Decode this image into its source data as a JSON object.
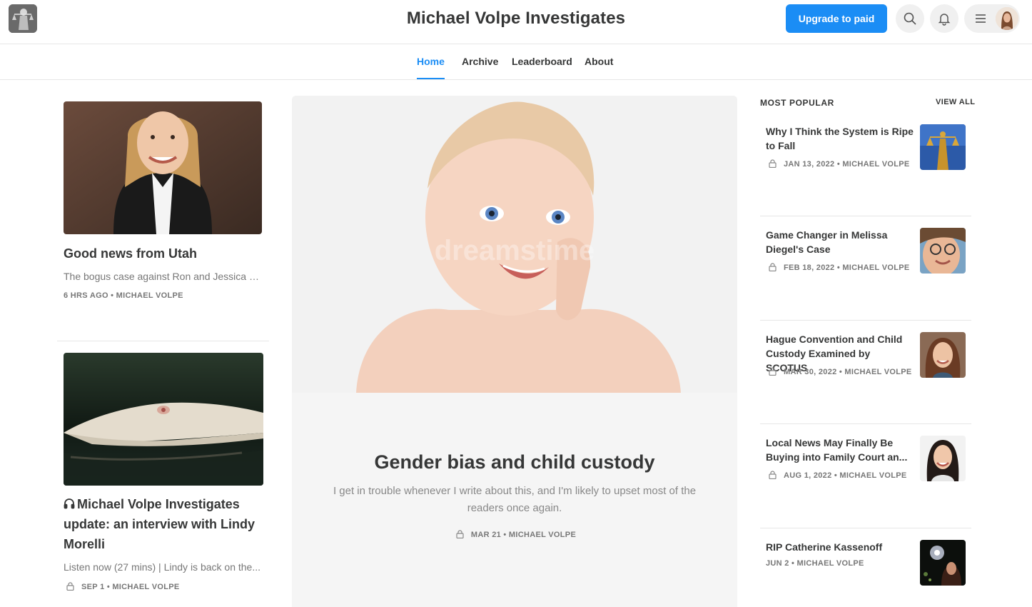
{
  "header": {
    "logo_icon": "publication-logo-icon",
    "site_title": "Michael Volpe Investigates",
    "upgrade_label": "Upgrade to paid",
    "search_icon": "search-icon",
    "bell_icon": "bell-icon",
    "menu_icon": "hamburger-menu-icon"
  },
  "nav": {
    "tabs": [
      {
        "label": "Home",
        "active": true
      },
      {
        "label": "Archive",
        "active": false
      },
      {
        "label": "Leaderboard",
        "active": false
      },
      {
        "label": "About",
        "active": false
      }
    ]
  },
  "left_posts": [
    {
      "title": "Good news from Utah",
      "subtitle": "The bogus case against Ron and Jessica Wes...",
      "meta": "6 HRS AGO • MICHAEL VOLPE",
      "locked": false
    },
    {
      "title": "Michael Volpe Investigates update: an interview with Lindy Morelli",
      "subtitle": "Listen now (27 mins) | Lindy is back on the...",
      "meta": "SEP 1 • MICHAEL VOLPE",
      "locked": true,
      "audio": true
    }
  ],
  "featured": {
    "title": "Gender bias and child custody",
    "subtitle": "I get in trouble whenever I write about this, and I'm likely to upset most of the readers once again.",
    "meta": "MAR 21 • MICHAEL VOLPE",
    "watermark": "dreamstime"
  },
  "popular": {
    "header": "MOST POPULAR",
    "view_all": "VIEW ALL",
    "items": [
      {
        "title": "Why I Think the System is Ripe to Fall",
        "meta": "JAN 13, 2022 • MICHAEL VOLPE",
        "locked": true
      },
      {
        "title": "Game Changer in Melissa Diegel's Case",
        "meta": "FEB 18, 2022 • MICHAEL VOLPE",
        "locked": true
      },
      {
        "title": "Hague Convention and Child Custody Examined by SCOTUS",
        "meta": "MAR 30, 2022 • MICHAEL VOLPE",
        "locked": true
      },
      {
        "title": "Local News May Finally Be Buying into Family Court an...",
        "meta": "AUG 1, 2022 • MICHAEL VOLPE",
        "locked": true
      },
      {
        "title": "RIP Catherine Kassenoff",
        "meta": "JUN 2 • MICHAEL VOLPE",
        "locked": false
      }
    ]
  },
  "colors": {
    "accent": "#1b8df5",
    "text": "#363737",
    "muted": "#777777",
    "divider": "#e6e6e6",
    "feature_bg": "#f5f5f5"
  }
}
